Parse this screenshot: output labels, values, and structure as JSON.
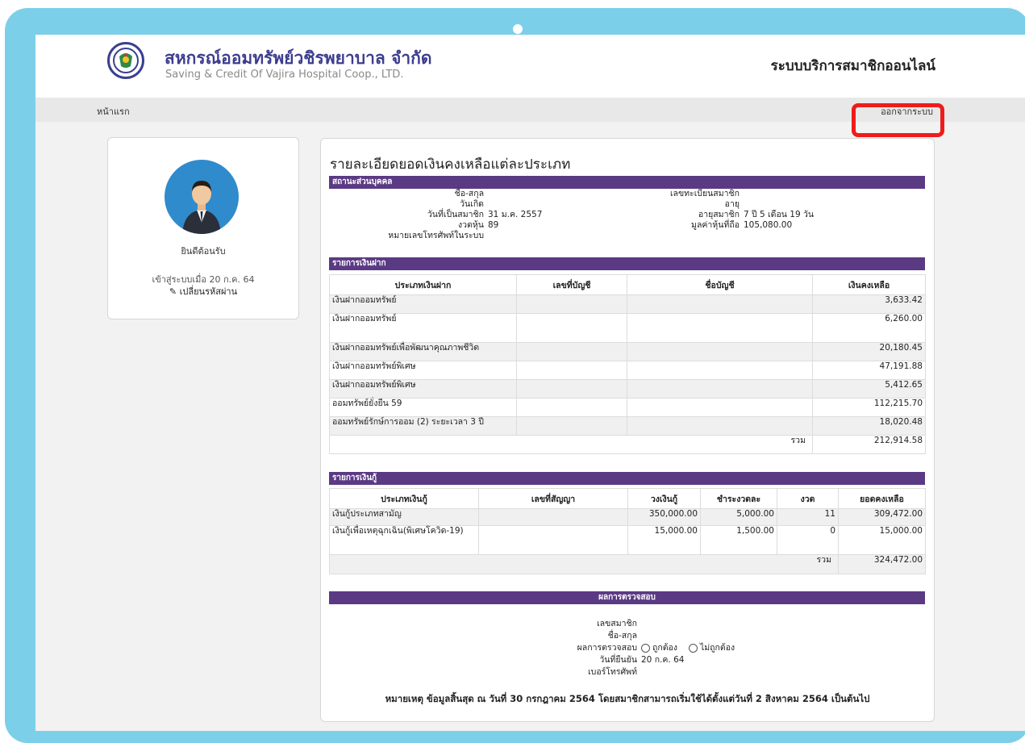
{
  "header": {
    "org_name_th": "สหกรณ์ออมทรัพย์วชิรพยาบาล จำกัด",
    "org_name_en": "Saving & Credit Of Vajira Hospital Coop., LTD.",
    "system_title": "ระบบบริการสมาชิกออนไลน์"
  },
  "nav": {
    "home": "หน้าแรก",
    "logout": "ออกจากระบบ"
  },
  "colors": {
    "section_bar": "#5b3a84",
    "highlight_box": "#ee1c1c",
    "frame": "#7ccfe9",
    "avatar_bg": "#2f8bcc"
  },
  "profile": {
    "avatar_icon": "user-avatar-icon",
    "welcome": "ยินดีต้อนรับ",
    "last_login": "เข้าสู่ระบบเมื่อ 20 ก.ค. 64",
    "change_password_icon": "pencil-icon",
    "change_password": "เปลี่ยนรหัสผ่าน"
  },
  "main": {
    "title": "รายละเอียดยอดเงินคงเหลือแต่ละประเภท",
    "personal": {
      "section": "สถานะส่วนบุคคล",
      "left": [
        {
          "label": "ชื่อ-สกุล",
          "value": ""
        },
        {
          "label": "วันเกิด",
          "value": ""
        },
        {
          "label": "วันที่เป็นสมาชิก",
          "value": "31 ม.ค. 2557"
        },
        {
          "label": "งวดหุ้น",
          "value": "89"
        },
        {
          "label": "หมายเลขโทรศัพท์ในระบบ",
          "value": ""
        }
      ],
      "right": [
        {
          "label": "เลขทะเบียนสมาชิก",
          "value": ""
        },
        {
          "label": "อายุ",
          "value": ""
        },
        {
          "label": "อายุสมาชิก",
          "value": "7 ปี 5 เดือน 19 วัน"
        },
        {
          "label": "มูลค่าหุ้นที่ถือ",
          "value": "105,080.00"
        }
      ]
    },
    "deposits": {
      "section": "รายการเงินฝาก",
      "columns": [
        "ประเภทเงินฝาก",
        "เลขที่บัญชี",
        "ชื่อบัญชี",
        "เงินคงเหลือ"
      ],
      "rows": [
        {
          "type": "เงินฝากออมทรัพย์",
          "account": "",
          "name": "",
          "balance": "3,633.42"
        },
        {
          "type": "เงินฝากออมทรัพย์",
          "account": "",
          "name": "",
          "balance": "6,260.00"
        },
        {
          "type": "เงินฝากออมทรัพย์เพื่อพัฒนาคุณภาพชีวิต",
          "account": "",
          "name": "",
          "balance": "20,180.45"
        },
        {
          "type": "เงินฝากออมทรัพย์พิเศษ",
          "account": "",
          "name": "",
          "balance": "47,191.88"
        },
        {
          "type": "เงินฝากออมทรัพย์พิเศษ",
          "account": "",
          "name": "",
          "balance": "5,412.65"
        },
        {
          "type": "ออมทรัพย์ยั่งยืน 59",
          "account": "",
          "name": "",
          "balance": "112,215.70"
        },
        {
          "type": "ออมทรัพย์รักษ์การออม (2) ระยะเวลา 3 ปี",
          "account": "",
          "name": "",
          "balance": "18,020.48"
        }
      ],
      "total_label": "รวม",
      "total": "212,914.58"
    },
    "loans": {
      "section": "รายการเงินกู้",
      "columns": [
        "ประเภทเงินกู้",
        "เลขที่สัญญา",
        "วงเงินกู้",
        "ชำระงวดละ",
        "งวด",
        "ยอดคงเหลือ"
      ],
      "rows": [
        {
          "type": "เงินกู้ประเภทสามัญ",
          "contract": "",
          "limit": "350,000.00",
          "installment": "5,000.00",
          "periods": "11",
          "balance": "309,472.00"
        },
        {
          "type": "เงินกู้เพื่อเหตุฉุกเฉิน(พิเศษโควิด-19)",
          "contract": "",
          "limit": "15,000.00",
          "installment": "1,500.00",
          "periods": "0",
          "balance": "15,000.00"
        }
      ],
      "total_label": "รวม",
      "total": "324,472.00"
    },
    "verification": {
      "section": "ผลการตรวจสอบ",
      "member_no_label": "เลขสมาชิก",
      "name_label": "ชื่อ-สกุล",
      "result_label": "ผลการตรวจสอบ",
      "option_correct": "ถูกต้อง",
      "option_incorrect": "ไม่ถูกต้อง",
      "confirm_date_label": "วันที่ยืนยัน",
      "confirm_date": "20 ก.ค. 64",
      "phone_label": "เบอร์โทรศัพท์"
    },
    "note": "หมายเหตุ ข้อมูลสิ้นสุด ณ วันที่ 30 กรกฎาคม 2564 โดยสมาชิกสามารถเริ่มใช้ได้ตั้งแต่วันที่ 2 สิงหาคม 2564 เป็นต้นไป"
  }
}
